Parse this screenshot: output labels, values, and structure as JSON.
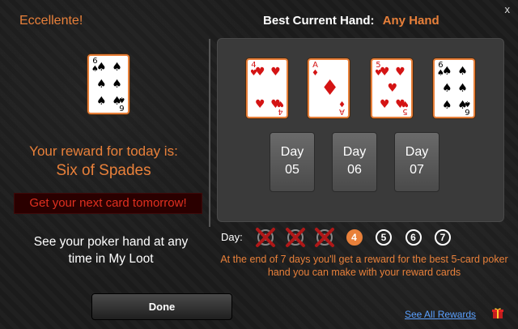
{
  "close_label": "x",
  "header": {
    "title": "Eccellente!",
    "best_hand_label": "Best Current Hand:",
    "best_hand_value": "Any Hand"
  },
  "reward": {
    "card": {
      "rank": "6",
      "suit": "♠",
      "color": "black"
    },
    "label": "Your reward for today is:",
    "card_name": "Six of Spades",
    "next_card_message": "Get your next card tomorrow!",
    "loot_message": "See your poker hand at any time in My Loot"
  },
  "hand_cards": [
    {
      "rank": "4",
      "suit": "♥",
      "color": "red"
    },
    {
      "rank": "A",
      "suit": "♦",
      "color": "red"
    },
    {
      "rank": "5",
      "suit": "♥",
      "color": "red"
    },
    {
      "rank": "6",
      "suit": "♠",
      "color": "black"
    }
  ],
  "upcoming_days": [
    {
      "label": "Day",
      "number": "05"
    },
    {
      "label": "Day",
      "number": "06"
    },
    {
      "label": "Day",
      "number": "07"
    }
  ],
  "day_tracker": {
    "label": "Day:",
    "days": [
      {
        "number": "1",
        "state": "done"
      },
      {
        "number": "2",
        "state": "done"
      },
      {
        "number": "3",
        "state": "done"
      },
      {
        "number": "4",
        "state": "current"
      },
      {
        "number": "5",
        "state": "upcoming"
      },
      {
        "number": "6",
        "state": "upcoming"
      },
      {
        "number": "7",
        "state": "upcoming"
      }
    ]
  },
  "end_info": "At the end of 7 days you'll get a reward for the best 5-card poker hand you can make with your reward cards",
  "done_button": "Done",
  "see_all_rewards": "See All Rewards",
  "colors": {
    "accent": "#e8803a",
    "banner_red": "#e03020",
    "link_blue": "#5aa0ff",
    "done_x_red": "#b01818"
  }
}
